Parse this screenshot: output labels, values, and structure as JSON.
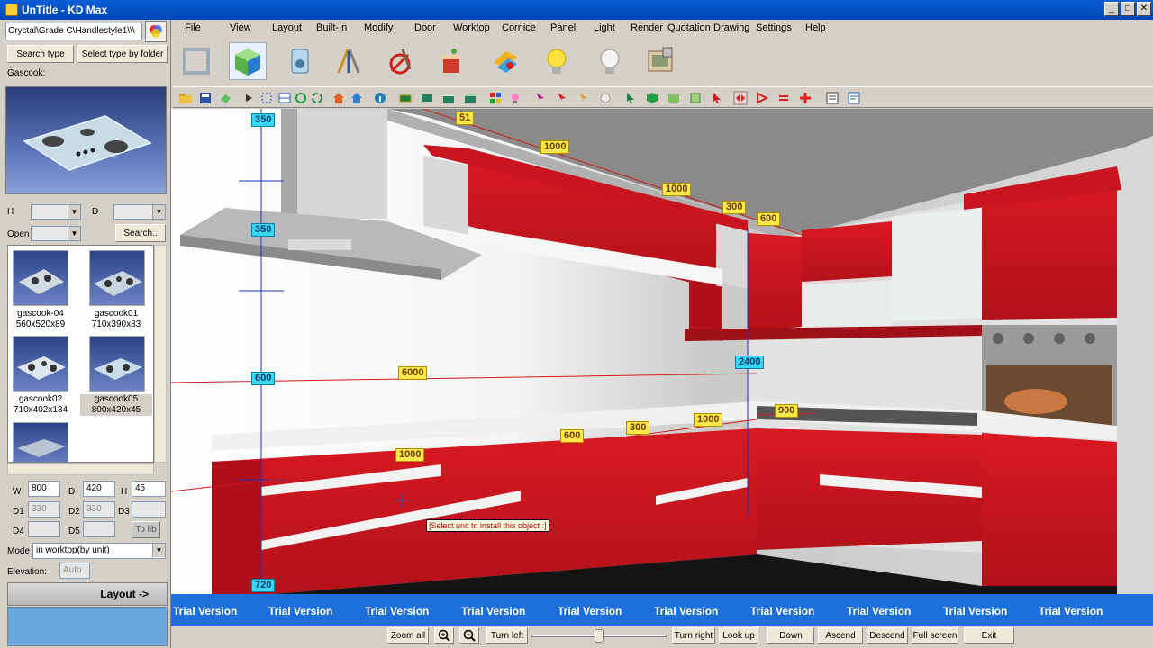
{
  "window": {
    "title": "UnTitle - KD Max",
    "min": "_",
    "max": "□",
    "close": "✕"
  },
  "left": {
    "path": "Crystal\\Grade C\\Handlestyle1\\\\\\",
    "search_type": "Search type",
    "select_by_folder": "Select type by folder",
    "category_label": "Gascook:",
    "h_label": "H",
    "d_label": "D",
    "open_label": "Open",
    "search_btn": "Search..",
    "items": [
      {
        "name": "gascook-04",
        "size": "560x520x89"
      },
      {
        "name": "gascook01",
        "size": "710x390x83"
      },
      {
        "name": "gascook02",
        "size": "710x402x134"
      },
      {
        "name": "gascook05",
        "size": "800x420x45"
      }
    ],
    "w_label": "W",
    "w_value": "800",
    "d2_label": "D",
    "d_value": "420",
    "h2_label": "H",
    "h_value": "45",
    "d1_label": "D1",
    "d1_value": "330",
    "dd2_label": "D2",
    "d2_value": "330",
    "d3_label": "D3",
    "d4_label": "D4",
    "d5_label": "D5",
    "to_lib": "To lib",
    "mode_label": "Mode",
    "mode_value": "in worktop(by unit)",
    "elevation_label": "Elevation:",
    "elevation_value": "Auto",
    "layout_btn": "Layout ->"
  },
  "menu": [
    "File",
    "View",
    "Layout",
    "Built-In",
    "Modify",
    "Door",
    "Worktop",
    "Cornice",
    "Panel",
    "Light",
    "Render",
    "Quotation",
    "Drawing",
    "Settings",
    "Help"
  ],
  "viewport": {
    "dims": {
      "d350a": "350",
      "d51": "51",
      "d1000a": "1000",
      "d1000b": "1000",
      "d300a": "300",
      "d600a": "600",
      "d350b": "350",
      "d2400": "2400",
      "d600b": "600",
      "d6000": "6000",
      "d900": "900",
      "d1000c": "1000",
      "d300b": "300",
      "d600c": "600",
      "d1000d": "1000",
      "d720": "720"
    },
    "tooltip": "[Select unit to install this object :]",
    "trial": "Trial Version"
  },
  "bottom": {
    "zoom_all": "Zoom all",
    "turn_left": "Turn left",
    "turn_right": "Turn right",
    "look_up": "Look up",
    "down": "Down",
    "ascend": "Ascend",
    "descend": "Descend",
    "full_screen": "Full screen",
    "exit": "Exit"
  }
}
